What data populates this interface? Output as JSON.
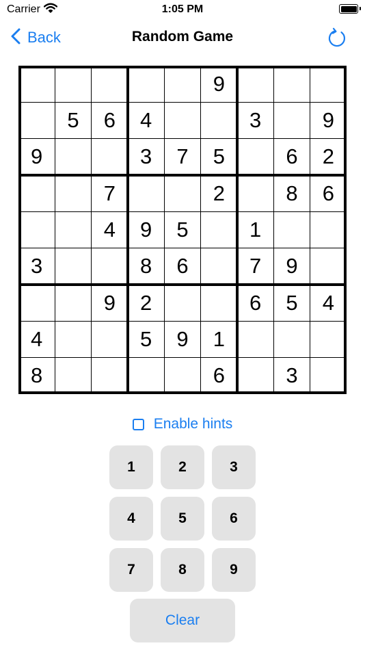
{
  "status_bar": {
    "carrier": "Carrier",
    "time": "1:05 PM"
  },
  "nav": {
    "back_label": "Back",
    "title": "Random Game"
  },
  "board": [
    [
      "",
      "",
      "",
      "",
      "",
      "9",
      "",
      "",
      ""
    ],
    [
      "",
      "5",
      "6",
      "4",
      "",
      "",
      "3",
      "",
      "9"
    ],
    [
      "9",
      "",
      "",
      "3",
      "7",
      "5",
      "",
      "6",
      "2"
    ],
    [
      "",
      "",
      "7",
      "",
      "",
      "2",
      "",
      "8",
      "6"
    ],
    [
      "",
      "",
      "4",
      "9",
      "5",
      "",
      "1",
      "",
      ""
    ],
    [
      "3",
      "",
      "",
      "8",
      "6",
      "",
      "7",
      "9",
      ""
    ],
    [
      "",
      "",
      "9",
      "2",
      "",
      "",
      "6",
      "5",
      "4"
    ],
    [
      "4",
      "",
      "",
      "5",
      "9",
      "1",
      "",
      "",
      ""
    ],
    [
      "8",
      "",
      "",
      "",
      "",
      "6",
      "",
      "3",
      ""
    ]
  ],
  "hints": {
    "label": "Enable hints",
    "checked": false
  },
  "keypad": {
    "keys": [
      "1",
      "2",
      "3",
      "4",
      "5",
      "6",
      "7",
      "8",
      "9"
    ],
    "clear_label": "Clear"
  },
  "colors": {
    "accent": "#1a7ef0",
    "key_bg": "#e3e3e3"
  }
}
